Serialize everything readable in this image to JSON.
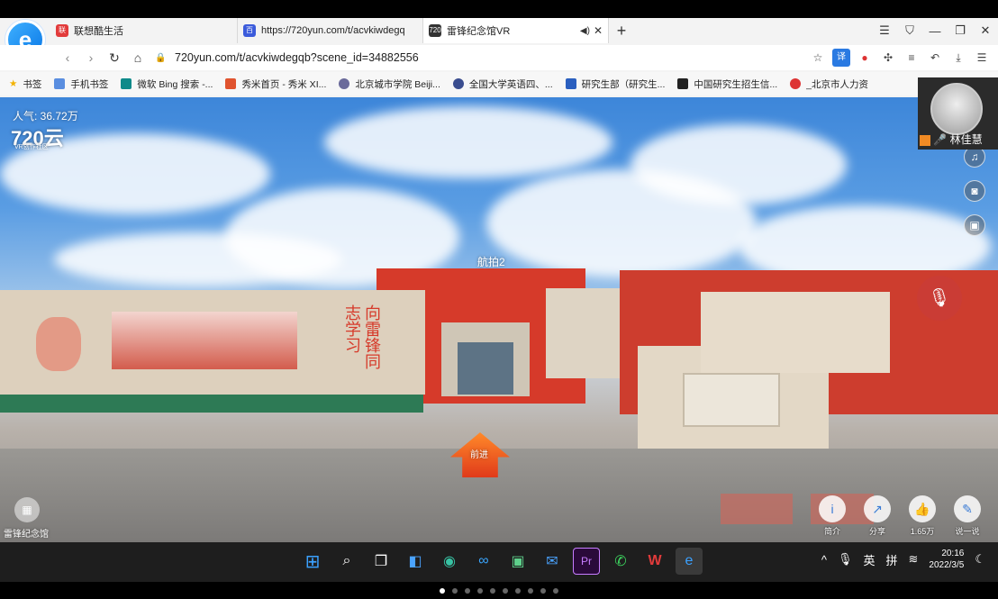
{
  "browser": {
    "tabs": [
      {
        "label": "联想酷生活",
        "icon": "lenovo-icon",
        "color": "#e23b3b"
      },
      {
        "label": "https://720yun.com/t/acvkiwdegq",
        "icon": "baidu-icon",
        "color": "#3b5bdb"
      },
      {
        "label": "雷锋纪念馆VR",
        "icon": "720-icon",
        "color": "#333333"
      }
    ],
    "new_tab": "+",
    "url": "720yun.com/t/acvkiwdegqb?scene_id=34882556",
    "bookmarks": [
      {
        "label": "书签",
        "icon": "star-icon",
        "color": "#f2b200"
      },
      {
        "label": "手机书签",
        "icon": "phone-icon",
        "color": "#5a8ee0"
      },
      {
        "label": "微软 Bing 搜索 -...",
        "icon": "bing-icon",
        "color": "#0f8a8a"
      },
      {
        "label": "秀米首页 - 秀米 XI...",
        "icon": "xiumi-icon",
        "color": "#e0532e"
      },
      {
        "label": "北京城市学院 Beiji...",
        "icon": "school-icon",
        "color": "#6a6a9a"
      },
      {
        "label": "全国大学英语四、...",
        "icon": "cet-icon",
        "color": "#3a4d8f"
      },
      {
        "label": "研究生部（研究生...",
        "icon": "flag-icon",
        "color": "#2a5fbf"
      },
      {
        "label": "中国研究生招生信...",
        "icon": "cap-icon",
        "color": "#222222"
      },
      {
        "label": "_北京市人力资",
        "icon": "hr-icon",
        "color": "#d33"
      }
    ]
  },
  "scene": {
    "popularity": "人气: 36.72万",
    "brand": "720云",
    "brand_sub": "VR创作社区",
    "hotspot": "航拍2",
    "scene_label": "雷锋纪念馆",
    "enter_label": "前进",
    "buttons": [
      {
        "label": "简介",
        "icon": "info-icon"
      },
      {
        "label": "分享",
        "icon": "share-icon"
      },
      {
        "label": "1.65万",
        "icon": "thumbs-up-icon"
      },
      {
        "label": "说一说",
        "icon": "comment-icon"
      }
    ]
  },
  "caller": {
    "name": "林佳慧"
  },
  "taskbar": {
    "ime_lang": "英",
    "ime_mode": "拼",
    "time": "20:16",
    "date": "2022/3/5"
  }
}
